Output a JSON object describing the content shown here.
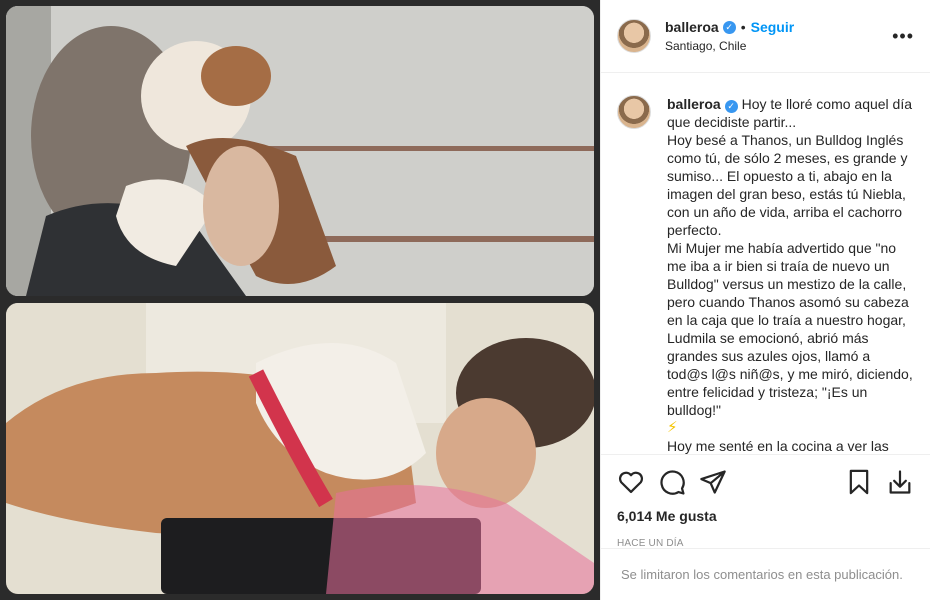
{
  "post": {
    "username": "balleroa",
    "follow_label": "Seguir",
    "separator": "•",
    "location": "Santiago, Chile",
    "more_label": "•••"
  },
  "caption": {
    "username": "balleroa",
    "text_lines": [
      " Hoy te lloré como aquel día que decidiste partir...",
      "Hoy besé a Thanos, un Bulldog Inglés como tú, de sólo 2 meses, es grande y sumiso... El opuesto a ti, abajo en la imagen del gran beso, estás tú Niebla, con un año de vida, arriba el cachorro perfecto.",
      "Mi Mujer me había advertido que \"no me iba a ir bien si traía de nuevo un Bulldog\" versus un mestizo de la calle, pero cuando Thanos asomó su cabeza en la caja que lo traía a nuestro hogar, Ludmila se emocionó, abrió más grandes sus azules ojos, llamó a tod@s l@s niñ@s, y me miró, diciendo, entre felicidad y tristeza; \"¡Es un bulldog!\"",
      "⚡",
      "Hoy me senté en la cocina a ver las fotos de Thanos, y entre medio, saliste"
    ]
  },
  "actions": {
    "like_icon": "heart-icon",
    "comment_icon": "comment-icon",
    "share_icon": "share-icon",
    "save_icon": "bookmark-icon",
    "download_icon": "download-icon",
    "likes_text": "6,014 Me gusta",
    "time_text": "HACE UN DÍA"
  },
  "comments": {
    "disabled_text": "Se limitaron los comentarios en esta publicación."
  },
  "colors": {
    "link": "#0095f6",
    "verified": "#3897f0",
    "muted": "#8e8e8e",
    "border": "#efefef"
  }
}
